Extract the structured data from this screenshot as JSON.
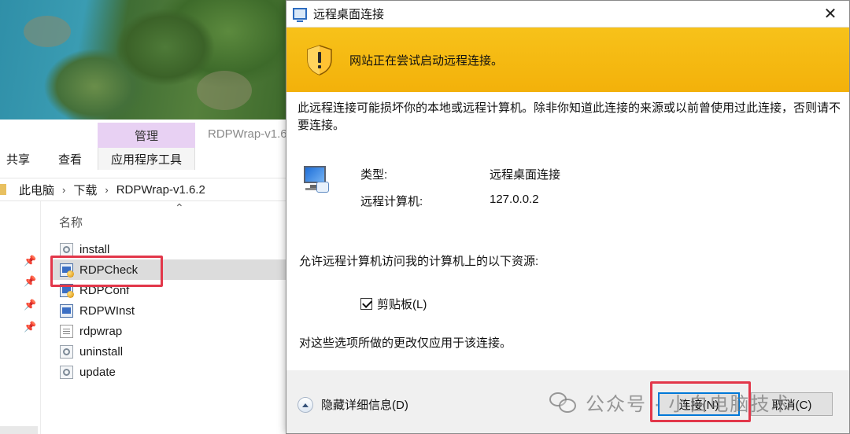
{
  "explorer": {
    "window_title": "RDPWrap-v1.6",
    "ribbon": {
      "share_tab": "共享",
      "view_tab": "查看",
      "manage_header": "管理",
      "app_tools_tab": "应用程序工具"
    },
    "breadcrumb": [
      "此电脑",
      "下载",
      "RDPWrap-v1.6.2"
    ],
    "column_name": "名称",
    "files": [
      {
        "name": "install",
        "icon": "settings-file-icon"
      },
      {
        "name": "RDPCheck",
        "icon": "app-icon",
        "selected": true
      },
      {
        "name": "RDPConf",
        "icon": "app-icon"
      },
      {
        "name": "RDPWInst",
        "icon": "app-icon"
      },
      {
        "name": "rdpwrap",
        "icon": "document-icon"
      },
      {
        "name": "uninstall",
        "icon": "settings-file-icon"
      },
      {
        "name": "update",
        "icon": "settings-file-icon"
      }
    ]
  },
  "dialog": {
    "title": "远程桌面连接",
    "warning": "网站正在尝试启动远程连接。",
    "risk_text": "此远程连接可能损坏你的本地或远程计算机。除非你知道此连接的来源或以前曾使用过此连接，否则请不要连接。",
    "type_label": "类型:",
    "type_value": "远程桌面连接",
    "remote_label": "远程计算机:",
    "remote_value": "127.0.0.2",
    "resources_label": "允许远程计算机访问我的计算机上的以下资源:",
    "clipboard_label": "剪贴板(L)",
    "clipboard_checked": true,
    "note": "对这些选项所做的更改仅应用于该连接。",
    "details_toggle": "隐藏详细信息(D)",
    "connect_button": "连接(N)",
    "cancel_button": "取消(C)"
  },
  "watermark": {
    "text": "公众号 · 小白电脑技术"
  },
  "colors": {
    "warning_band": "#f5b814",
    "highlight_red": "#e2374a",
    "manage_purple": "#e8d1f3"
  }
}
